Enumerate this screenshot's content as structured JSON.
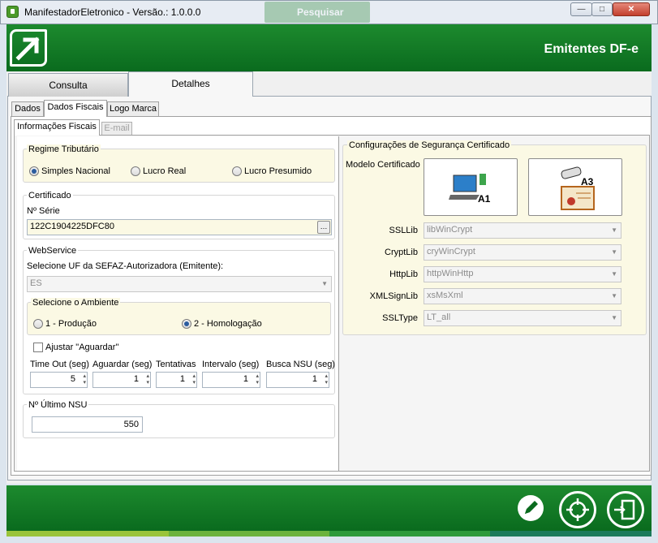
{
  "window": {
    "title": "ManifestadorEletronico - Versão.: 1.0.0.0",
    "min": "—",
    "max": "□",
    "close": "✕"
  },
  "ghost_button": "Pesquisar",
  "header": {
    "title": "Emitentes DF-e"
  },
  "tabs": [
    "Consulta",
    "Detalhes"
  ],
  "subtabs": [
    "Dados",
    "Dados Fiscais",
    "Logo Marca"
  ],
  "inner_tabs": [
    "Informações Fiscais",
    "E-mail"
  ],
  "regime": {
    "label": "Regime Tributário",
    "options": [
      "Simples Nacional",
      "Lucro Real",
      "Lucro Presumido"
    ],
    "selected": "Simples Nacional"
  },
  "certificado": {
    "label": "Certificado",
    "serie_label": "Nº Série",
    "serie_value": "122C1904225DFC80",
    "browse": "…"
  },
  "webservice": {
    "label": "WebService",
    "uf_label": "Selecione UF da SEFAZ-Autorizadora (Emitente):",
    "uf_value": "ES",
    "ambiente_label": "Selecione o Ambiente",
    "ambiente_options": [
      "1 - Produção",
      "2 - Homologação"
    ],
    "ambiente_selected": "2 - Homologação",
    "ajustar_label": "Ajustar \"Aguardar\"",
    "fields": [
      {
        "label": "Time Out (seg)",
        "value": "5"
      },
      {
        "label": "Aguardar (seg)",
        "value": "1"
      },
      {
        "label": "Tentativas",
        "value": "1"
      },
      {
        "label": "Intervalo (seg)",
        "value": "1"
      },
      {
        "label": "Busca NSU (seg)",
        "value": "1"
      }
    ]
  },
  "nsu": {
    "label": "Nº Último NSU",
    "value": "550"
  },
  "seguranca": {
    "label": "Configurações de Segurança Certificado",
    "modelo_label": "Modelo Certificado",
    "a1": "A1",
    "a3": "A3",
    "rows": [
      {
        "label": "SSLLib",
        "value": "libWinCrypt"
      },
      {
        "label": "CryptLib",
        "value": "cryWinCrypt"
      },
      {
        "label": "HttpLib",
        "value": "httpWinHttp"
      },
      {
        "label": "XMLSignLib",
        "value": "xsMsXml"
      },
      {
        "label": "SSLType",
        "value": "LT_all"
      }
    ]
  },
  "colors": {
    "brand_green": "#0a6b1e",
    "field_yellow": "#fbf9e4"
  }
}
